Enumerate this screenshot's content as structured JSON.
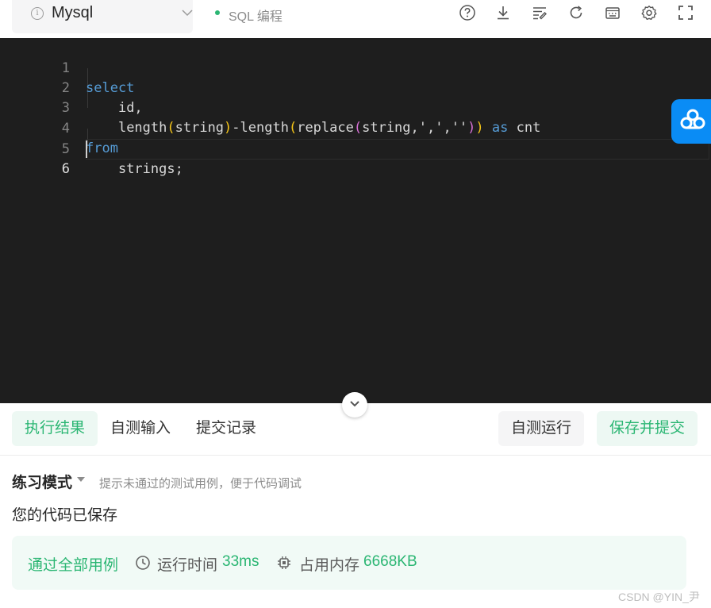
{
  "toolbar": {
    "language": "Mysql",
    "mode": "SQL 编程",
    "icons": [
      "help-icon",
      "download-icon",
      "format-icon",
      "reset-icon",
      "keyboard-icon",
      "settings-icon",
      "fullscreen-icon"
    ]
  },
  "editor": {
    "line_numbers": [
      "1",
      "2",
      "3",
      "4",
      "5",
      "6"
    ],
    "lines": {
      "l1_kw": "select",
      "l2": "id,",
      "l3_a": "length",
      "l3_p1o": "(",
      "l3_b": "string",
      "l3_p1c": ")",
      "l3_c": "-length",
      "l3_d": "replace",
      "l3_p2o": "(",
      "l3_e": "string,',',''",
      "l3_p2c": ")",
      "l3_kw": "as",
      "l3_f": "cnt",
      "l4_kw": "from",
      "l5": "strings;"
    }
  },
  "tabs": [
    "执行结果",
    "自测输入",
    "提交记录"
  ],
  "buttons": {
    "run": "自测运行",
    "submit": "保存并提交"
  },
  "result": {
    "mode_title": "练习模式",
    "mode_hint": "提示未通过的测试用例，便于代码调试",
    "saved": "您的代码已保存",
    "pass": "通过全部用例",
    "runtime_label": "运行时间",
    "runtime_value": "33ms",
    "memory_label": "占用内存",
    "memory_value": "6668KB"
  },
  "watermark": "CSDN @YIN_尹",
  "colors": {
    "accent": "#2bb673",
    "editor_bg": "#1e1e1e",
    "keyword": "#569cd6",
    "cloud": "#0a8cf5"
  }
}
